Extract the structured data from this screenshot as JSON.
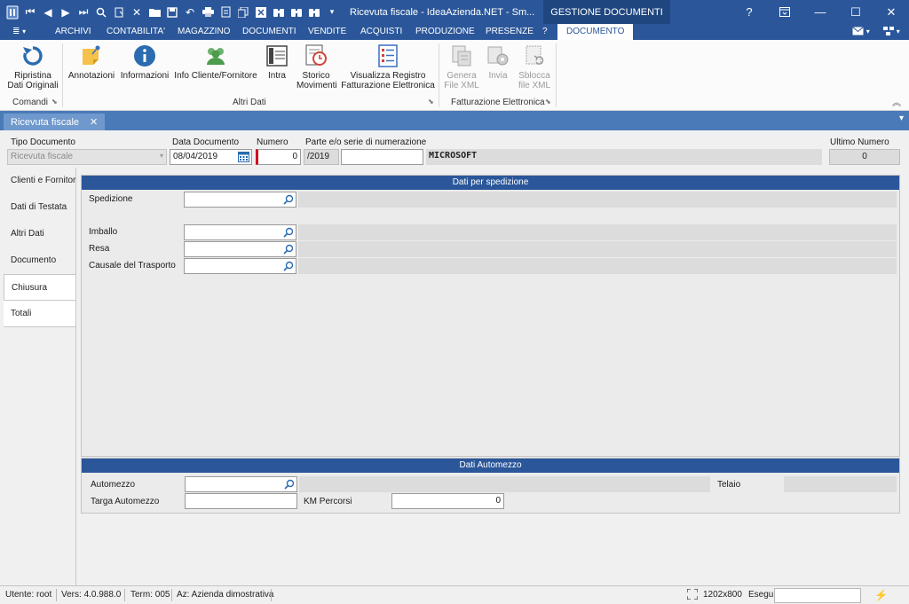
{
  "window": {
    "title": "Ricevuta fiscale - IdeaAzienda.NET - Sm...",
    "context_tab": "GESTIONE DOCUMENTI",
    "help": "?",
    "restore_icon": "restore-icon",
    "minimize": "—",
    "maximize": "☐",
    "close": "✕"
  },
  "menu": {
    "app_button": "≣",
    "items": [
      "ARCHIVI",
      "CONTABILITA'",
      "MAGAZZINO",
      "DOCUMENTI",
      "VENDITE",
      "ACQUISTI",
      "PRODUZIONE",
      "PRESENZE",
      "?"
    ],
    "active": "DOCUMENTO"
  },
  "ribbon": {
    "comandi": {
      "ripristina": "Ripristina\nDati Originali",
      "group": "Comandi"
    },
    "altri": {
      "annotazioni": "Annotazioni",
      "informazioni": "Informazioni",
      "info_cliente": "Info Cliente/Fornitore",
      "intra": "Intra",
      "storico": "Storico\nMovimenti",
      "visualizza": "Visualizza Registro\nFatturazione Elettronica",
      "group": "Altri Dati"
    },
    "fe": {
      "genera": "Genera\nFile XML",
      "invia": "Invia",
      "sblocca": "Sblocca\nfile XML",
      "group": "Fatturazione Elettronica"
    },
    "collapse": "︽"
  },
  "doc_tab": {
    "label": "Ricevuta fiscale",
    "close": "✕",
    "menu": "▾"
  },
  "header": {
    "tipo_label": "Tipo Documento",
    "tipo_value": "Ricevuta fiscale",
    "data_label": "Data Documento",
    "data_value": "08/04/2019",
    "numero_label": "Numero",
    "numero_value": "0",
    "parte_label": "Parte e/o serie di numerazione",
    "serie_value": "/2019",
    "serie_extra": "",
    "company": "MICROSOFT",
    "ultimo_label": "Ultimo Numero",
    "ultimo_value": "0"
  },
  "nav": [
    "Clienti e Fornitori",
    "Dati di Testata",
    "Altri Dati",
    "Documento",
    "Chiusura",
    "Totali"
  ],
  "nav_selected": "Chiusura",
  "spedizione": {
    "title": "Dati per spedizione",
    "spedizione": "Spedizione",
    "imballo": "Imballo",
    "resa": "Resa",
    "causale": "Causale del Trasporto"
  },
  "automezzo": {
    "title": "Dati Automezzo",
    "automezzo": "Automezzo",
    "targa": "Targa Automezzo",
    "km_label": "KM Percorsi",
    "km_value": "0",
    "telaio": "Telaio"
  },
  "status": {
    "utente": "Utente: root",
    "versione": "Vers: 4.0.988.0",
    "term": "Term: 005",
    "azienda": "Az: Azienda dimostrativa",
    "resolution": "1202x800",
    "esegui": "Esegui",
    "bolt": "⚡"
  },
  "colors": {
    "accent": "#2b579a",
    "tab_strip": "#4a7ab8",
    "numero_marker": "#d0021b"
  }
}
